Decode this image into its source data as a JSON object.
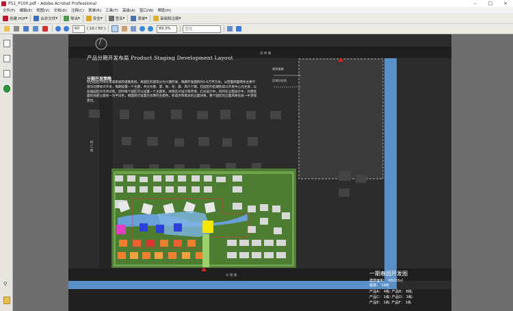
{
  "window": {
    "title": "P51_P100.pdf - Adobe Acrobat Professional"
  },
  "menu": [
    "文件(F)",
    "编辑(E)",
    "视图(V)",
    "文档(D)",
    "注释(C)",
    "表单(R)",
    "工具(T)",
    "高级(A)",
    "窗口(W)",
    "帮助(H)"
  ],
  "toolbar": {
    "create_pdf": "创建 PDF",
    "merge": "合并文件",
    "export": "导出",
    "secure": "安全",
    "sign": "签名",
    "forms": "表单",
    "review": "审阅和注释"
  },
  "nav": {
    "page_value": "60",
    "page_count": "( 10 / 50 )",
    "zoom": "89.3%",
    "find_placeholder": "查找"
  },
  "doc": {
    "title": "产品分期开发布局 Product Staging Development Layout",
    "subtitle": "分期开发策略",
    "paragraph": "综合园区的绿化景观系统和道路系统，将园区的建筑分为六期开发，每期开发面积约5-6万平方米。以西面南面两条主要干道向北侧依次开发，每期设置一个主题，共分为春、夏、秋、冬、晨、风六个期，在园区的前期形成以开发中心为主体，以加强园区的可辨识性。同时每个园区可以设置一个主题色，体现在VI设计和环境、灯光设计中，同时在立面设计中，外建筑面的局部立面统一为半白色，侧面则可设置为浓厚的主题色，形成步移景异的立面效果，整个园区的立面风格在统一中求得变化。",
    "legend_line1": "规划道路",
    "legend_line2": "区域分红线",
    "road_north": "滨 林 路",
    "road_south": "文 德 路",
    "road_west": "桃 江 路",
    "phase_title": "一期春园开发图",
    "stats": [
      "建筑面积： 68203㎡",
      "栋数： 18栋",
      "产品A： 4栋;   产品B： 8栋;",
      "产品C： 1栋;   产品D： 3栋;",
      "产品E： 1栋;   产品F： 1栋"
    ]
  },
  "colors": {
    "accent_red": "#d02020",
    "water": "#5a8fc8",
    "green": "#5a8a3a",
    "yellow": "#f4e600",
    "magenta": "#e040c0",
    "blue": "#2a40d8",
    "orange": "#f08030"
  }
}
